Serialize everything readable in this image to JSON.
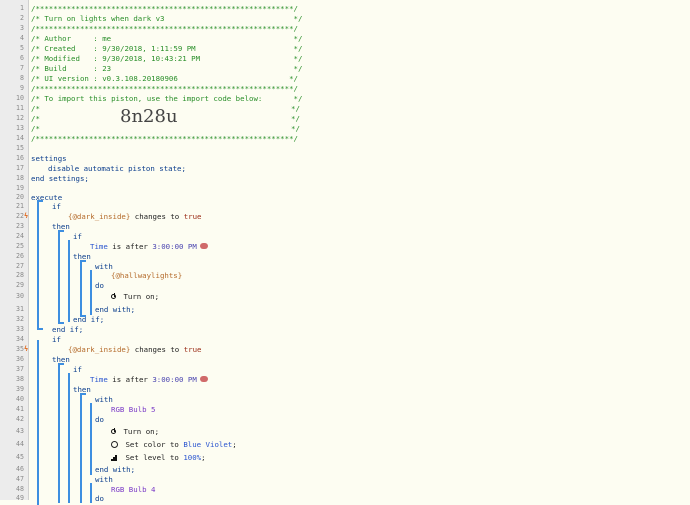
{
  "editor": {
    "line_numbers": [
      "1",
      "2",
      "3",
      "4",
      "5",
      "6",
      "7",
      "8",
      "9",
      "10",
      "11",
      "12",
      "13",
      "14",
      "15",
      "16",
      "17",
      "18",
      "19",
      "20",
      "21",
      "22",
      "23",
      "24",
      "25",
      "26",
      "27",
      "28",
      "29",
      "30",
      "31",
      "32",
      "33",
      "34",
      "35",
      "36",
      "37",
      "38",
      "39",
      "40",
      "41",
      "42",
      "43",
      "44",
      "45",
      "46",
      "47",
      "48",
      "49"
    ],
    "banner": {
      "border": "/**********************************************************/",
      "title": "/* Turn on lights when dark v3                             */",
      "author": "/* Author     : me                                         */",
      "created": "/* Created    : 9/30/2018, 1:11:59 PM                      */",
      "modified": "/* Modified   : 9/30/2018, 10:43:21 PM                     */",
      "build": "/* Build      : 23                                         */",
      "ui_version": "/* UI version : v0.3.108.20180906                         */",
      "import_hint": "/* To import this piston, use the import code below:       */",
      "blank_left": "/*",
      "blank_right": "*/",
      "import_code": "8n28u"
    },
    "settings_kw": "settings",
    "disable_state": "disable automatic piston state;",
    "end_settings": "end settings;",
    "execute_kw": "execute",
    "if_kw": "if",
    "then_kw": "then",
    "with_kw": "with",
    "do_kw": "do",
    "end_if": "end if;",
    "end_with": "end with;",
    "dark_inside": "{@dark_inside}",
    "changes_to": "changes to",
    "true_kw": "true",
    "time_kw": "Time",
    "is_after": "is after",
    "time_value": "3:00:00 PM",
    "hallway_lights": "{@hallwaylights}",
    "turn_on": "Turn on;",
    "rgb_bulb_5": "RGB Bulb 5",
    "rgb_bulb_4": "RGB Bulb 4",
    "set_color_to": "Set color to",
    "color_value": "Blue Violet",
    "semicolon": ";",
    "set_level_to": "Set level to",
    "level_value": "100%",
    "trigger_mark": "ϟ"
  }
}
